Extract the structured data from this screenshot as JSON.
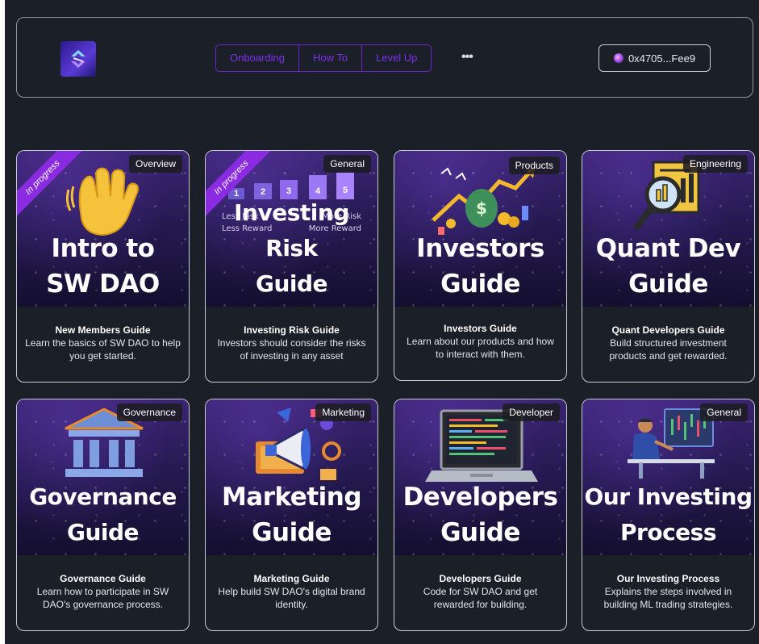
{
  "header": {
    "nav_tabs": [
      {
        "label": "Onboarding"
      },
      {
        "label": "How To"
      },
      {
        "label": "Level Up"
      }
    ],
    "more_label": "•••",
    "wallet_address": "0x4705...Fee9"
  },
  "cards": [
    {
      "tag": "Overview",
      "status": "In progress",
      "image_title_line1": "Intro to",
      "image_title_line2": "SW DAO",
      "title": "New Members Guide",
      "description": "Learn the basics of SW DAO to help you get started."
    },
    {
      "tag": "General",
      "status": "In progress",
      "image_title_line1": "Investing Risk",
      "image_title_line2": "Guide",
      "risk_levels": [
        "1",
        "2",
        "3",
        "4",
        "5"
      ],
      "less_risk": "Less Risk",
      "less_reward": "Less Reward",
      "more_risk": "More Risk",
      "more_reward": "More Reward",
      "title": "Investing Risk Guide",
      "description": "Investors should consider the risks of investing in any asset"
    },
    {
      "tag": "Products",
      "image_title_line1": "Investors",
      "image_title_line2": "Guide",
      "title": "Investors Guide",
      "description": "Learn about our products and how to interact with them."
    },
    {
      "tag": "Engineering",
      "image_title_line1": "Quant Dev",
      "image_title_line2": "Guide",
      "title": "Quant Developers Guide",
      "description": "Build structured investment products and get rewarded."
    },
    {
      "tag": "Governance",
      "image_title_line1": "Governance",
      "image_title_line2": "Guide",
      "title": "Governance Guide",
      "description": "Learn how to participate in SW DAO's governance process."
    },
    {
      "tag": "Marketing",
      "image_title_line1": "Marketing",
      "image_title_line2": "Guide",
      "title": "Marketing Guide",
      "description": "Help build SW DAO's digital brand identity."
    },
    {
      "tag": "Developer",
      "image_title_line1": "Developers",
      "image_title_line2": "Guide",
      "title": "Developers Guide",
      "description": "Code for SW DAO and get rewarded for building."
    },
    {
      "tag": "General",
      "image_title_line1": "Our Investing",
      "image_title_line2": "Process",
      "title": "Our Investing Process",
      "description": "Explains the steps involved in building ML trading strategies."
    }
  ]
}
